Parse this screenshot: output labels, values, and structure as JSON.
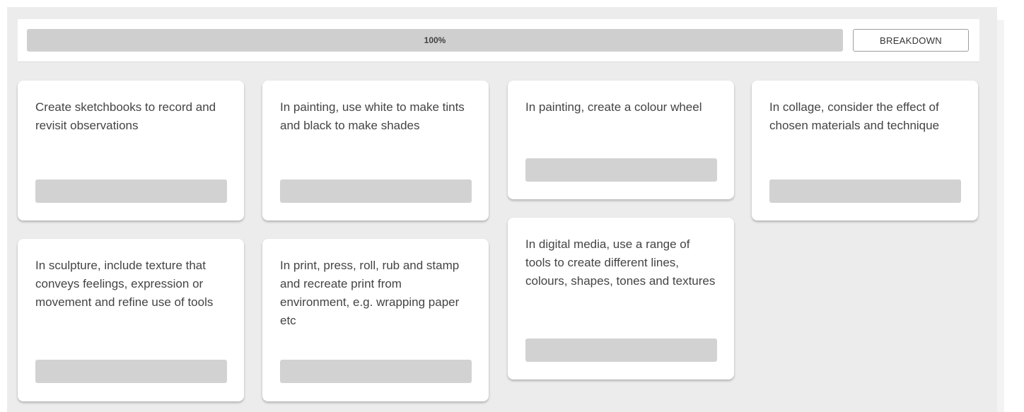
{
  "progress": {
    "label": "100%",
    "value": 1.0
  },
  "toolbar": {
    "breakdown_label": "BREAKDOWN"
  },
  "cards": [
    {
      "text": "Create sketchbooks to record and revisit observations"
    },
    {
      "text": "In painting, use white to make tints and black to make shades"
    },
    {
      "text": "In painting, create a colour wheel"
    },
    {
      "text": "In collage, consider the effect of chosen materials and technique"
    },
    {
      "text": "In sculpture, include texture that conveys feelings, expression or movement and refine use of tools"
    },
    {
      "text": "In print, press, roll, rub and stamp and recreate print from environment, e.g. wrapping paper etc"
    },
    {
      "text": "In digital media, use a range of tools to create different lines, colours, shapes, tones and textures"
    }
  ]
}
